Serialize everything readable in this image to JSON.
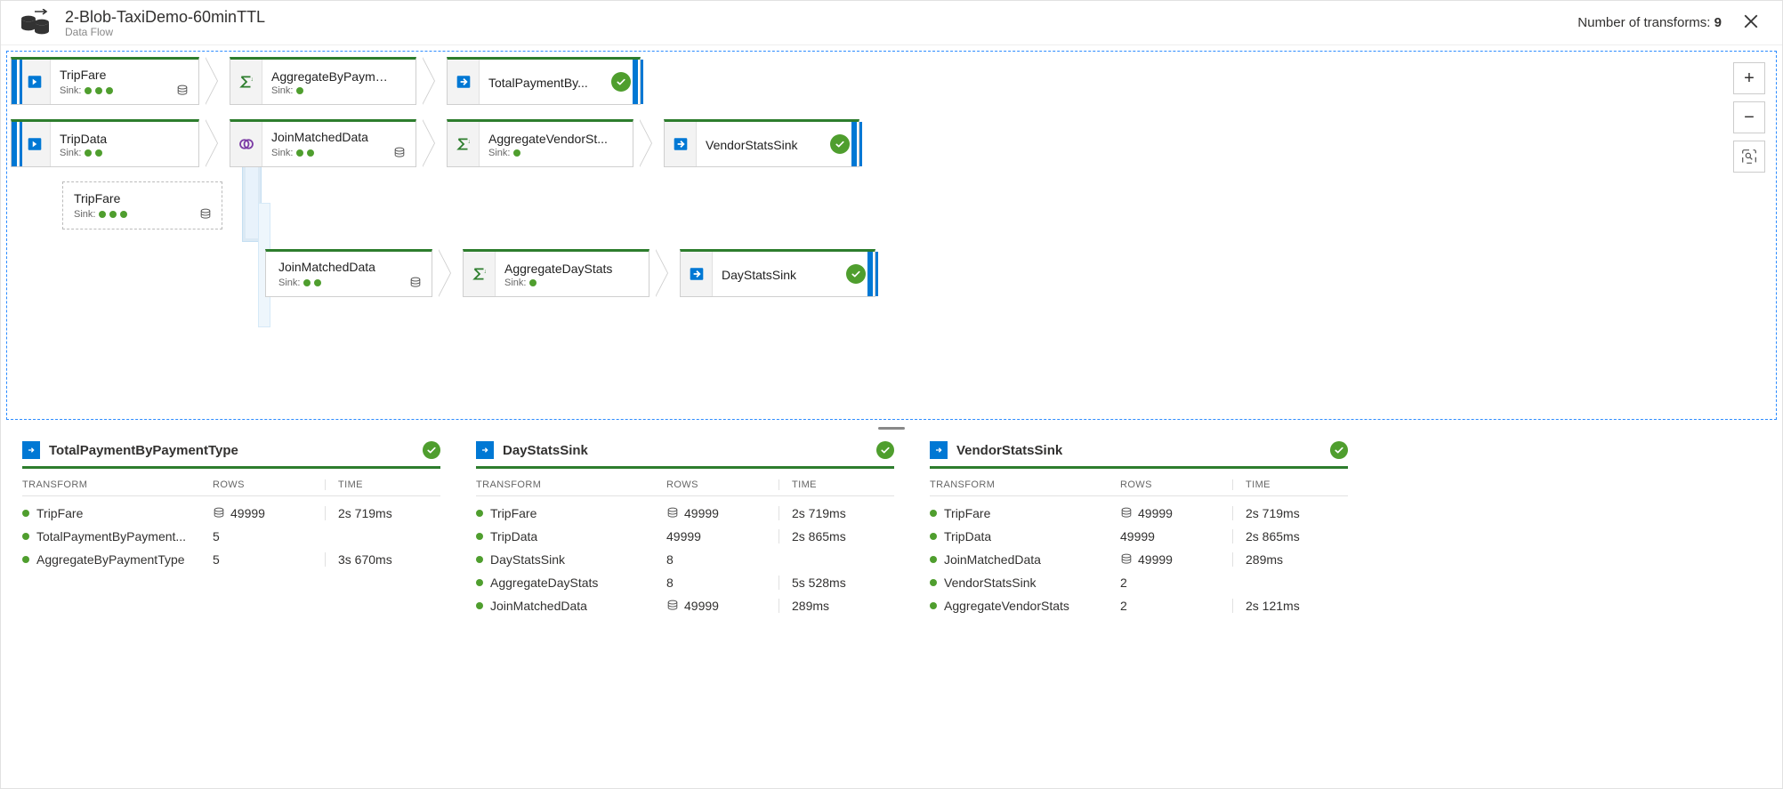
{
  "header": {
    "title": "2-Blob-TaxiDemo-60minTTL",
    "subtitle": "Data Flow",
    "transform_label": "Number of transforms:",
    "transform_count": "9"
  },
  "nodes": {
    "tripFare": {
      "title": "TripFare",
      "sinkLabel": "Sink:",
      "dots": 3,
      "hasBarrel": true
    },
    "aggPay": {
      "title": "AggregateByPayme...",
      "sinkLabel": "Sink:",
      "dots": 1
    },
    "totalPay": {
      "title": "TotalPaymentBy..."
    },
    "tripData": {
      "title": "TripData",
      "sinkLabel": "Sink:",
      "dots": 2
    },
    "joinMatched": {
      "title": "JoinMatchedData",
      "sinkLabel": "Sink:",
      "dots": 2,
      "hasBarrel": true
    },
    "aggVendor": {
      "title": "AggregateVendorSt...",
      "sinkLabel": "Sink:",
      "dots": 1
    },
    "vendorSink": {
      "title": "VendorStatsSink"
    },
    "tripFareGhost": {
      "title": "TripFare",
      "sinkLabel": "Sink:",
      "dots": 3,
      "hasBarrel": true
    },
    "joinMatched2": {
      "title": "JoinMatchedData",
      "sinkLabel": "Sink:",
      "dots": 2,
      "hasBarrel": true
    },
    "aggDay": {
      "title": "AggregateDayStats",
      "sinkLabel": "Sink:",
      "dots": 1
    },
    "daySink": {
      "title": "DayStatsSink"
    }
  },
  "panels": [
    {
      "name": "TotalPaymentByPaymentType",
      "columns": {
        "transform": "TRANSFORM",
        "rows": "ROWS",
        "time": "TIME"
      },
      "rows": [
        {
          "name": "TripFare",
          "rows": "49999",
          "barrel": true,
          "time": "2s 719ms"
        },
        {
          "name": "TotalPaymentByPayment...",
          "rows": "5",
          "barrel": false,
          "time": ""
        },
        {
          "name": "AggregateByPaymentType",
          "rows": "5",
          "barrel": false,
          "time": "3s 670ms"
        }
      ]
    },
    {
      "name": "DayStatsSink",
      "columns": {
        "transform": "TRANSFORM",
        "rows": "ROWS",
        "time": "TIME"
      },
      "rows": [
        {
          "name": "TripFare",
          "rows": "49999",
          "barrel": true,
          "time": "2s 719ms"
        },
        {
          "name": "TripData",
          "rows": "49999",
          "barrel": false,
          "time": "2s 865ms"
        },
        {
          "name": "DayStatsSink",
          "rows": "8",
          "barrel": false,
          "time": ""
        },
        {
          "name": "AggregateDayStats",
          "rows": "8",
          "barrel": false,
          "time": "5s 528ms"
        },
        {
          "name": "JoinMatchedData",
          "rows": "49999",
          "barrel": true,
          "time": "289ms"
        }
      ]
    },
    {
      "name": "VendorStatsSink",
      "columns": {
        "transform": "TRANSFORM",
        "rows": "ROWS",
        "time": "TIME"
      },
      "rows": [
        {
          "name": "TripFare",
          "rows": "49999",
          "barrel": true,
          "time": "2s 719ms"
        },
        {
          "name": "TripData",
          "rows": "49999",
          "barrel": false,
          "time": "2s 865ms"
        },
        {
          "name": "JoinMatchedData",
          "rows": "49999",
          "barrel": true,
          "time": "289ms"
        },
        {
          "name": "VendorStatsSink",
          "rows": "2",
          "barrel": false,
          "time": ""
        },
        {
          "name": "AggregateVendorStats",
          "rows": "2",
          "barrel": false,
          "time": "2s 121ms"
        }
      ]
    }
  ],
  "zoom": {
    "in": "+",
    "out": "−",
    "fit": "⛶"
  }
}
